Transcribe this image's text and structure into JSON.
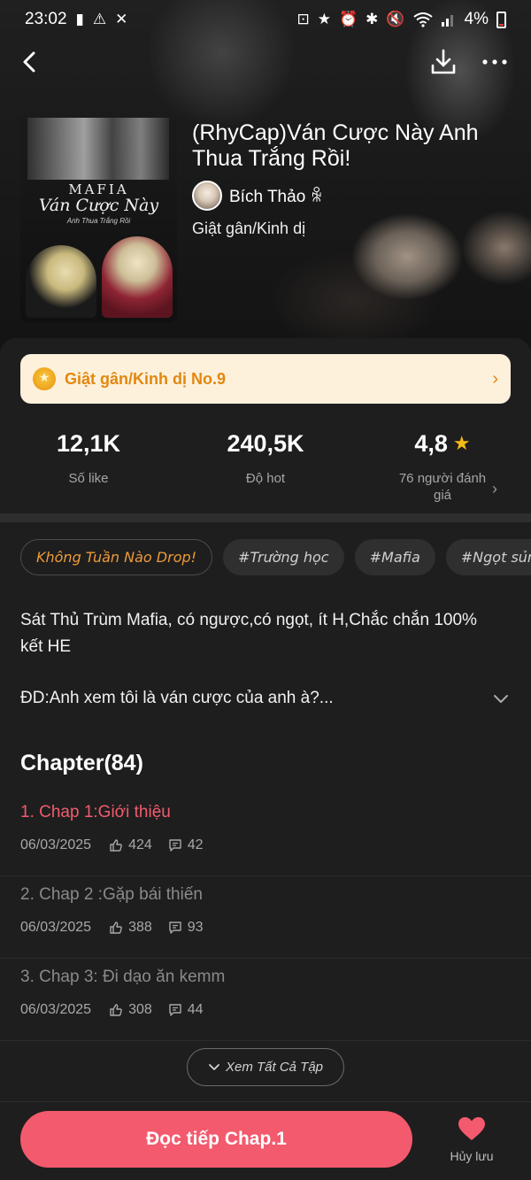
{
  "status": {
    "time": "23:02",
    "battery": "4%"
  },
  "book": {
    "title": "(RhyCap)Ván Cược Này Anh Thua Trắng Rồi!",
    "author": "Bích Thảo ꆜ",
    "genre": "Giật gân/Kinh dị",
    "cover": {
      "line1": "MAFIA",
      "line2": "Ván Cược Này",
      "line3": "Anh Thua Trắng Rồi"
    }
  },
  "rank": {
    "label": "Giật gân/Kinh dị No.9"
  },
  "stats": [
    {
      "value": "12,1K",
      "label": "Số like"
    },
    {
      "value": "240,5K",
      "label": "Độ hot"
    },
    {
      "value": "4,8",
      "label": "76 người đánh giá"
    }
  ],
  "tags": [
    "Không Tuần Nào Drop!",
    "#Trường học",
    "#Mafia",
    "#Ngọt sủng"
  ],
  "synopsis": "Sát Thủ Trùm Mafia, có ngược,có ngọt, ít H,Chắc chắn 100% kết HE",
  "quote": "ĐD:Anh xem tôi là ván cược của anh à?...",
  "chapter_heading": "Chapter(84)",
  "chapters": [
    {
      "title": "1. Chap 1:Giới thiệu",
      "date": "06/03/2025",
      "likes": "424",
      "comments": "42"
    },
    {
      "title": "2. Chap 2 :Gặp bái thiến",
      "date": "06/03/2025",
      "likes": "388",
      "comments": "93"
    },
    {
      "title": "3. Chap 3: Đi dạo ăn kemm",
      "date": "06/03/2025",
      "likes": "308",
      "comments": "44"
    }
  ],
  "see_all": "Xem Tất Cả Tập",
  "read_button": "Đọc tiếp Chap.1",
  "save_label": "Hủy lưu",
  "colors": {
    "accent": "#f35a6d",
    "rank_text": "#e3870f",
    "rank_bg": "#fdf1dc",
    "star": "#f6b91a",
    "background": "#1e1e1e"
  }
}
